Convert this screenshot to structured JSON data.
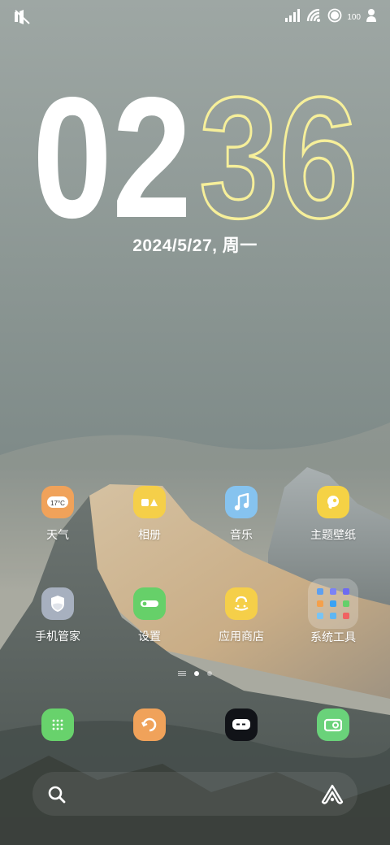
{
  "status_bar": {
    "left_icon": "mute-icon",
    "signal_icon": "signal-icon",
    "wifi_icon": "wifi-icon",
    "battery_level": "100",
    "profile_icon": "person-icon"
  },
  "clock": {
    "hours": "02",
    "minutes": "36"
  },
  "date": "2024/5/27, 周一",
  "colors": {
    "clock_hours": "#ffffff",
    "clock_minutes_outline": "#f6ef9a",
    "weather": "#f0a25a",
    "gallery": "#f5cf49",
    "music": "#86c3ef",
    "theme": "#f5d245",
    "security": "#a7b0bf",
    "settings": "#66d069",
    "app_store": "#f5cf49",
    "dialer": "#68d26c",
    "browser": "#f0a25a",
    "messages": "#111318",
    "wallet": "#6ad27a"
  },
  "apps": [
    {
      "label": "天气",
      "icon": "weather-icon",
      "badge": "17°C"
    },
    {
      "label": "相册",
      "icon": "gallery-icon"
    },
    {
      "label": "音乐",
      "icon": "music-icon"
    },
    {
      "label": "主题壁纸",
      "icon": "theme-icon"
    },
    {
      "label": "手机管家",
      "icon": "shield-icon"
    },
    {
      "label": "设置",
      "icon": "settings-icon"
    },
    {
      "label": "应用商店",
      "icon": "app-store-icon"
    },
    {
      "label": "系统工具",
      "icon": "folder-icon"
    }
  ],
  "page_indicator": {
    "pages": 2,
    "current": 1
  },
  "dock": [
    {
      "icon": "dialer-icon"
    },
    {
      "icon": "browser-icon"
    },
    {
      "icon": "messages-icon"
    },
    {
      "icon": "wallet-icon"
    }
  ],
  "bottom_bar": {
    "left_icon": "search-icon",
    "right_icon": "assistant-icon"
  }
}
